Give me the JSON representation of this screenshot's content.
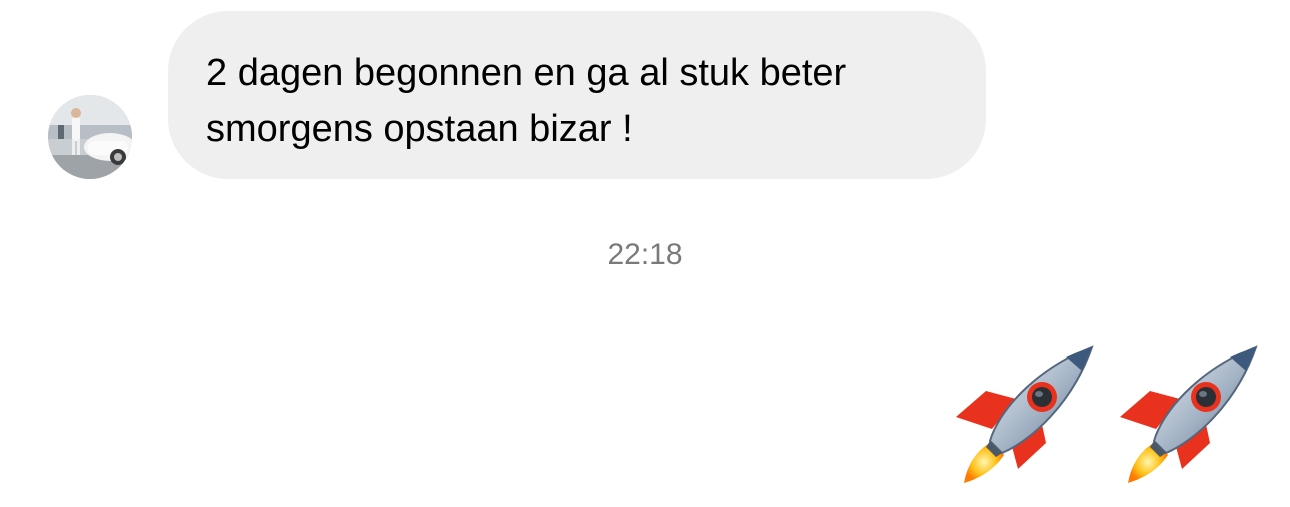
{
  "conversation": {
    "incoming": {
      "text": "2 dagen begonnen en ga al stuk beter\nsmorgens opstaan bizar !",
      "bubble_color": "#efefef"
    },
    "timestamp": "22:18",
    "outgoing": {
      "emoji": [
        "rocket-emoji",
        "rocket-emoji"
      ]
    }
  },
  "colors": {
    "background": "#ffffff",
    "bubble": "#efefef",
    "text": "#000000",
    "timestamp": "#7a7a7a"
  }
}
